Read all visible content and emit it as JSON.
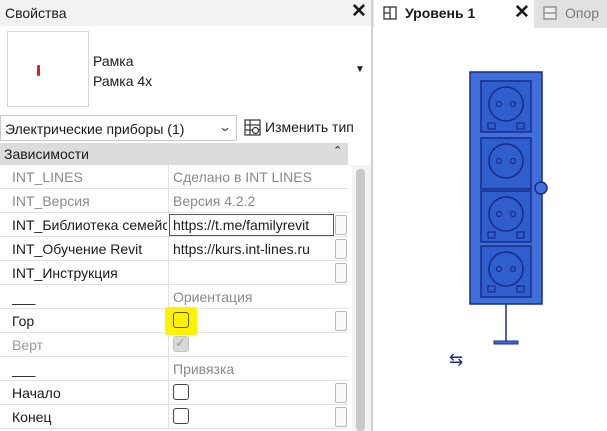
{
  "properties": {
    "title": "Свойства",
    "close_glyph": "✕",
    "type_family": "Рамка",
    "type_name": "Рамка 4x",
    "dropdown_glyph": "▼",
    "filter_value": "Электрические приборы (1)",
    "filter_chevron": "⌄",
    "edit_type_label": "Изменить тип",
    "section_title": "Зависимости",
    "collapse_glyph": "⌃",
    "rows": [
      {
        "name": "INT_LINES",
        "value": "Сделано в INT LINES"
      },
      {
        "name": "INT_Версия",
        "value": "Версия 4.2.2"
      },
      {
        "name": "INT_Библиотека семейств",
        "value": "https://t.me/familyrevit"
      },
      {
        "name": "INT_Обучение Revit",
        "value": "https://kurs.int-lines.ru"
      },
      {
        "name": "INT_Инструкция",
        "value": ""
      },
      {
        "name": "___",
        "value": "Ориентация"
      },
      {
        "name": "Гор",
        "checked": false
      },
      {
        "name": "Верт",
        "checked": true
      },
      {
        "name": "___",
        "value": "Привязка"
      },
      {
        "name": "Начало",
        "checked": false
      },
      {
        "name": "Конец",
        "checked": false
      }
    ]
  },
  "view_tabs": [
    {
      "label": "Уровень 1",
      "active": true,
      "close_glyph": "✕"
    },
    {
      "label": "Опор",
      "active": false
    }
  ],
  "view": {
    "flip_glyph": "⇆"
  },
  "colors": {
    "socket_fill": "#3f6fd8",
    "socket_stroke": "#1b2a8a",
    "highlight": "#fff200"
  }
}
